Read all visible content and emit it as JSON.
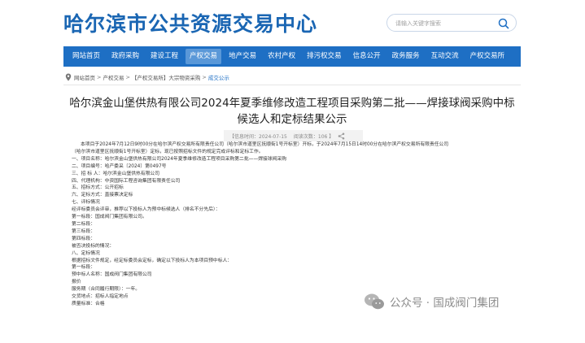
{
  "header": {
    "site_title": "哈尔滨市公共资源交易中心",
    "search_placeholder": "请输入关键字搜索"
  },
  "nav": {
    "items": [
      "网站首页",
      "政府采购",
      "建设工程",
      "产权交易",
      "地产交易",
      "农村产权",
      "排污权交易",
      "信息公开",
      "政务服务",
      "互动交流",
      "产权交易所"
    ],
    "active": "产权交易"
  },
  "breadcrumb": {
    "items": [
      "网站首页",
      "产权交易",
      "【产权交易所】大宗物资采购",
      "成交公示"
    ]
  },
  "article": {
    "title_line1": "哈尔滨金山堡供热有限公司2024年夏季维修改造工程项目采购第二批——焊接球阀采购中标",
    "title_line2": "候选人和定标结果公示",
    "meta_date": "【信息时间：2024-07-15",
    "meta_views": "阅读次数：106 】",
    "lines": [
      {
        "text": "本项目于2024年7月12日9时00分在哈尔滨产权交易所有限责任公司（哈尔滨市道里区抚顺街1号开标室）开标，于2024年7月15日14时00分在哈尔滨产权交易所有限责任公司",
        "indent": true
      },
      {
        "text": "（哈尔滨市道里区抚顺街1号开标室）定标，现已按照招标文件的规定完成评标和定标工作。",
        "indent": false
      },
      {
        "text": "一、项目名称：哈尔滨金山堡供热有限公司2024年夏季维修改造工程项目采购第二批——焊接球阀采购",
        "indent": false
      },
      {
        "text": "二、项目编号：哈产委采〔2024〕第0497号",
        "indent": false
      },
      {
        "text": "三、招 标 人：哈尔滨金山堡供热有限公司",
        "indent": false
      },
      {
        "text": "四、代理机构：中资国际工程咨询集团有限责任公司",
        "indent": false
      },
      {
        "text": "五、招标方式：公开招标",
        "indent": false
      },
      {
        "text": "六、定标方式：直接票决定标",
        "indent": false
      },
      {
        "text": "七、评标情况",
        "indent": false
      },
      {
        "text": "经评标委员会评审，推荐以下投标人为预中标候选人（排名不分先后）：",
        "indent": false
      },
      {
        "text": "第一标段：国成阀门集团有限公司。",
        "indent": false
      },
      {
        "text": "第二标段：",
        "indent": false
      },
      {
        "text": "第三标段：",
        "indent": false
      },
      {
        "text": "第四标段：",
        "indent": false
      },
      {
        "text": "被否决投标的情况：",
        "indent": false
      },
      {
        "text": "八、定标情况",
        "indent": false
      },
      {
        "text": "根据招标文件规定，经定标委员会定标，确定以下投标人为本项目预中标人：",
        "indent": false
      },
      {
        "text": "第一标段：",
        "indent": false
      },
      {
        "text": "预中标人名称：国成阀门集团有限公司",
        "indent": false
      },
      {
        "text": "报价",
        "indent": false
      },
      {
        "text": "服务期（合同履行期限）：一年。",
        "indent": false
      },
      {
        "text": "交货地点：招标人指定地点",
        "indent": false
      },
      {
        "text": "质量标准：合格",
        "indent": false
      }
    ]
  },
  "watermark": {
    "text": "公众号 · 国成阀门集团"
  },
  "colors": {
    "brand_blue": "#1a66b3",
    "nav_bg": "#1e6fc4",
    "nav_active": "#5a98d8"
  }
}
